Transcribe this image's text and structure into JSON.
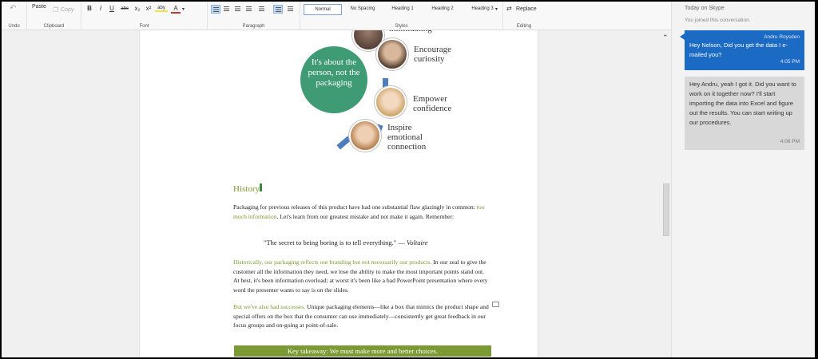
{
  "ribbon": {
    "undo_label": "Undo",
    "clipboard": {
      "paste": "Paste",
      "copy": "Copy",
      "group": "Clipboard"
    },
    "font": {
      "bold": "B",
      "italic": "I",
      "underline": "U",
      "strike": "abc",
      "subscript": "x₂",
      "superscript": "x²",
      "highlight": "aby",
      "color": "A",
      "group": "Font"
    },
    "paragraph": {
      "group": "Paragraph"
    },
    "styles": {
      "items": [
        "Normal",
        "No Spacing",
        "Heading 1",
        "Heading 2",
        "Heading 3"
      ],
      "group": "Styles"
    },
    "editing": {
      "replace": "Replace",
      "group": "Editing"
    }
  },
  "diagram": {
    "center": "It's about the person, not the packaging",
    "callouts": [
      "intimidating",
      "Encourage curiosity",
      "Empower confidence",
      "Inspire emotional connection"
    ],
    "colors": {
      "circle": "#3f9b73",
      "arc": "#4e7dbd"
    }
  },
  "document": {
    "heading": "History",
    "p1_a": "Packaging for previous releases of this product have had one substantial flaw glazingly in common: ",
    "p1_highlight": "too much information",
    "p1_b": ". Let's learn from our greatest mistake and not make it again. Remember:",
    "quote": "\"The secret to being boring is to tell everything.\" — ",
    "quote_author": "Voltaire",
    "p2_highlight": "Historically, our packaging reflects our branding but not necessarily our products.",
    "p2_rest": " In our zeal to give the customer all the information they need, we lose the ability to make the most important points stand out. At best, it's been information overload; at worst it's been like a bad PowerPoint presentation where every word the presenter wants to say is on the slides.",
    "p3_highlight": "But we've also had successes.",
    "p3_rest": " Unique packaging elements—like a box that mimics the product shape and special offers on the box that the consumer can use immediately—consistently get great feedback in our focus groups and on-going at point-of-sale.",
    "takeaway": "Key takeaway: We must make more and better choices.",
    "accent_color": "#7a9a2e"
  },
  "skype": {
    "header": "Today on Skype",
    "joined": "You joined this conversation.",
    "messages": [
      {
        "sender": "Andru Roysden",
        "text": "Hey Nelson, Did you get the data I e-mailed you?",
        "time": "4:05 PM"
      },
      {
        "sender": "",
        "text": "Hey Andru, yeah I got it. Did you want to work on it together now? I'll start importing the data into Excel and figure out the results. You can start writing up our procedures.",
        "time": "4:06 PM"
      }
    ]
  }
}
